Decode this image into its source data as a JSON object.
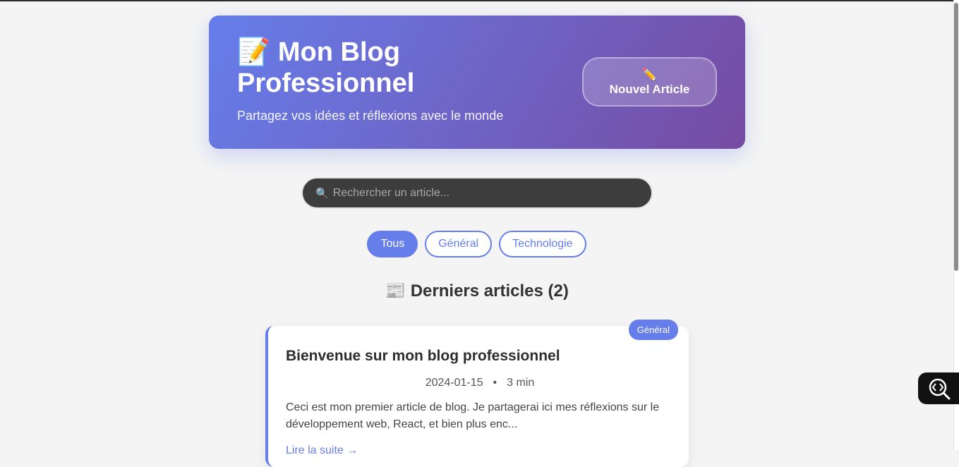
{
  "header": {
    "title_icon": "📝",
    "title": "Mon Blog Professionnel",
    "subtitle": "Partagez vos idées et réflexions avec le monde",
    "new_article_icon": "✏️",
    "new_article_label": "Nouvel Article"
  },
  "search": {
    "icon": "🔍",
    "placeholder": "Rechercher un article..."
  },
  "filters": [
    {
      "label": "Tous",
      "active": true
    },
    {
      "label": "Général",
      "active": false
    },
    {
      "label": "Technologie",
      "active": false
    }
  ],
  "section": {
    "icon": "📰",
    "title": "Derniers articles (2)"
  },
  "articles": [
    {
      "category": "Général",
      "title": "Bienvenue sur mon blog professionnel",
      "date": "2024-01-15",
      "separator": "•",
      "read_time": "3 min",
      "excerpt": "Ceci est mon premier article de blog. Je partagerai ici mes réflexions sur le développement web, React, et bien plus enc...",
      "read_more": "Lire la suite →"
    }
  ],
  "colors": {
    "accent": "#667eea",
    "gradient_end": "#764ba2",
    "background": "#f4f4f4"
  }
}
